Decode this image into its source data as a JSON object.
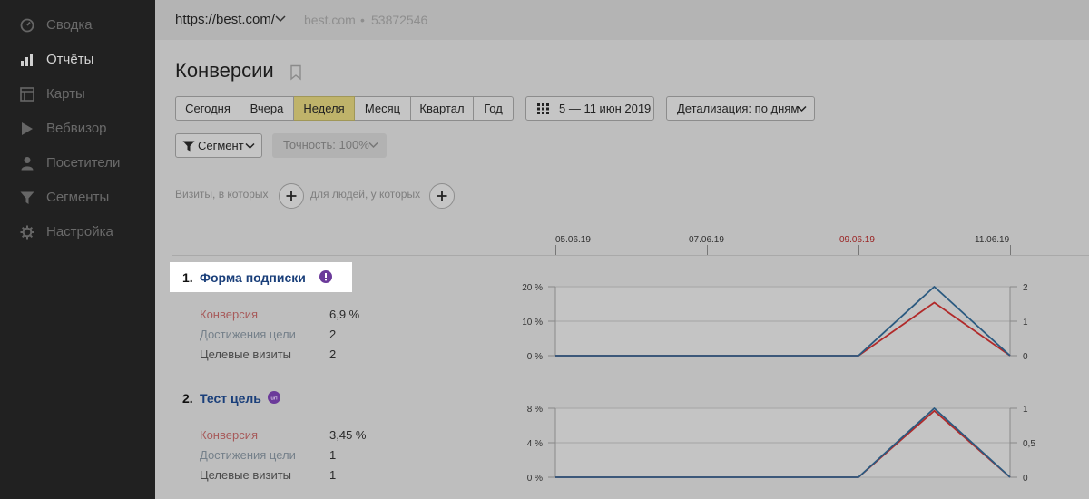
{
  "sidebar": {
    "items": [
      {
        "label": "Сводка",
        "icon": "dashboard-icon",
        "active": false
      },
      {
        "label": "Отчёты",
        "icon": "bar-chart-icon",
        "active": true
      },
      {
        "label": "Карты",
        "icon": "map-icon",
        "active": false
      },
      {
        "label": "Вебвизор",
        "icon": "play-icon",
        "active": false
      },
      {
        "label": "Посетители",
        "icon": "user-icon",
        "active": false
      },
      {
        "label": "Сегменты",
        "icon": "funnel-icon",
        "active": false
      },
      {
        "label": "Настройка",
        "icon": "gear-icon",
        "active": false
      }
    ]
  },
  "header": {
    "site_url": "https://best.com/",
    "site_name": "best.com",
    "separator": "•",
    "counter_id": "53872546"
  },
  "page": {
    "title": "Конверсии"
  },
  "period": {
    "options": [
      "Сегодня",
      "Вчера",
      "Неделя",
      "Месяц",
      "Квартал",
      "Год"
    ],
    "selected": "Неделя"
  },
  "date_range": "5 — 11 июн 2019",
  "detail": "Детализация: по дням",
  "segment_label": "Сегмент",
  "accuracy": "Точность: 100%",
  "filters": {
    "visits_label": "Визиты, в которых",
    "people_label": "для людей, у которых"
  },
  "timeline": {
    "dates": [
      "05.06.19",
      "07.06.19",
      "09.06.19",
      "11.06.19"
    ],
    "highlight": "09.06.19"
  },
  "colors": {
    "conversion_line": "#b12a2a",
    "reach_line": "#2b5a80",
    "active_period": "#bfb36a",
    "goal_link": "#1a3f7a",
    "badge": "#6b3a9a"
  },
  "goals": [
    {
      "number": "1.",
      "name": "Форма подписки",
      "badge_icon": "info-badge-icon",
      "metrics": [
        {
          "label": "Конверсия",
          "value": "6,9 %"
        },
        {
          "label": "Достижения цели",
          "value": "2"
        },
        {
          "label": "Целевые визиты",
          "value": "2"
        }
      ]
    },
    {
      "number": "2.",
      "name": "Тест цель",
      "badge_icon": "url-badge-icon",
      "metrics": [
        {
          "label": "Конверсия",
          "value": "3,45 %"
        },
        {
          "label": "Достижения цели",
          "value": "1"
        },
        {
          "label": "Целевые визиты",
          "value": "1"
        }
      ]
    }
  ],
  "chart_data": [
    {
      "type": "line",
      "x": [
        "05.06.19",
        "06.06.19",
        "07.06.19",
        "08.06.19",
        "09.06.19",
        "10.06.19",
        "11.06.19"
      ],
      "left_axis": {
        "ticks": [
          "20 %",
          "10 %",
          "0 %"
        ],
        "ylim": [
          0,
          20
        ]
      },
      "right_axis": {
        "ticks": [
          "2",
          "1",
          "0"
        ],
        "ylim": [
          0,
          2
        ]
      },
      "series": [
        {
          "axis": "left",
          "values": [
            0,
            0,
            0,
            0,
            0,
            15.4,
            0
          ]
        },
        {
          "axis": "right",
          "values": [
            0,
            0,
            0,
            0,
            0,
            2,
            0
          ]
        }
      ]
    },
    {
      "type": "line",
      "x": [
        "05.06.19",
        "06.06.19",
        "07.06.19",
        "08.06.19",
        "09.06.19",
        "10.06.19",
        "11.06.19"
      ],
      "left_axis": {
        "ticks": [
          "8 %",
          "4 %",
          "0 %"
        ],
        "ylim": [
          0,
          8
        ]
      },
      "right_axis": {
        "ticks": [
          "1",
          "0,5",
          "0"
        ],
        "ylim": [
          0,
          1
        ]
      },
      "series": [
        {
          "axis": "left",
          "values": [
            0,
            0,
            0,
            0,
            0,
            7.7,
            0
          ]
        },
        {
          "axis": "right",
          "values": [
            0,
            0,
            0,
            0,
            0,
            1,
            0
          ]
        }
      ]
    }
  ]
}
